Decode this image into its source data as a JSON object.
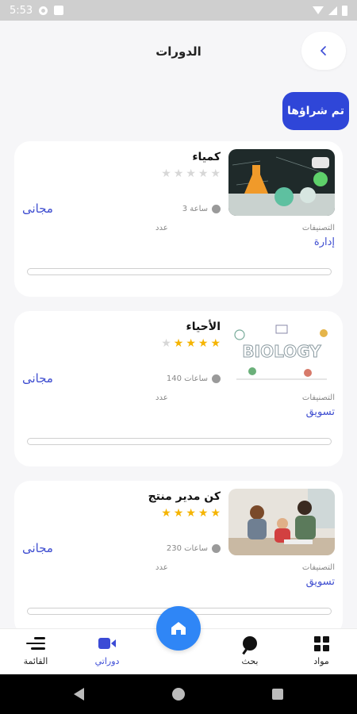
{
  "status_bar": {
    "time": "5:53"
  },
  "header": {
    "title": "الدورات",
    "back_icon": "chevron-left-icon"
  },
  "subscribed_button": "تم شراؤها",
  "courses": [
    {
      "title": "كمياء",
      "rating": 0,
      "duration": "3 ساعة",
      "price": "مجانى",
      "category_label": "التصنيفات",
      "count_label": "عدد",
      "category": "إدارة",
      "progress": 0
    },
    {
      "title": "الأحياء",
      "rating": 3.5,
      "duration": "140 ساعات",
      "price": "مجانى",
      "category_label": "التصنيفات",
      "count_label": "عدد",
      "category": "تسويق",
      "progress": 0
    },
    {
      "title": "كن مدير منتج",
      "rating": 5,
      "duration": "230 ساعات",
      "price": "مجانى",
      "category_label": "التصنيفات",
      "count_label": "عدد",
      "category": "تسويق",
      "progress": 0
    }
  ],
  "bottom_nav": {
    "materials": "مواد",
    "search": "بحث",
    "my_courses": "دوراتي",
    "menu": "القائمة"
  },
  "colors": {
    "accent": "#2f46d8",
    "home_fab": "#2f86f6",
    "star": "#f5b400",
    "link": "#3e4dd0"
  }
}
